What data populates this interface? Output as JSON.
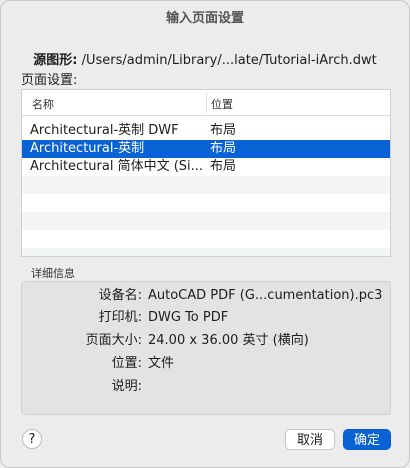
{
  "window": {
    "title": "输入页面设置"
  },
  "source": {
    "label": "源图形:",
    "path": "/Users/admin/Library/...late/Tutorial-iArch.dwt"
  },
  "page_setups": {
    "label": "页面设置:",
    "columns": [
      "名称",
      "位置"
    ],
    "rows": [
      {
        "name": "Architectural-英制 DWF",
        "location": "布局",
        "selected": false
      },
      {
        "name": "Architectural-英制",
        "location": "布局",
        "selected": true
      },
      {
        "name": "Architectural 简体中文 (Si...",
        "location": "布局",
        "selected": false
      }
    ]
  },
  "details": {
    "label": "详细信息",
    "items": [
      {
        "key": "设备名:",
        "value": "AutoCAD PDF (G...cumentation).pc3"
      },
      {
        "key": "打印机:",
        "value": "DWG To PDF"
      },
      {
        "key": "页面大小:",
        "value": "24.00 x 36.00 英寸 (横向)"
      },
      {
        "key": "位置:",
        "value": "文件"
      },
      {
        "key": "说明:",
        "value": ""
      }
    ]
  },
  "buttons": {
    "help": "?",
    "cancel": "取消",
    "ok": "确定"
  },
  "colors": {
    "accent": "#0a63d6"
  }
}
